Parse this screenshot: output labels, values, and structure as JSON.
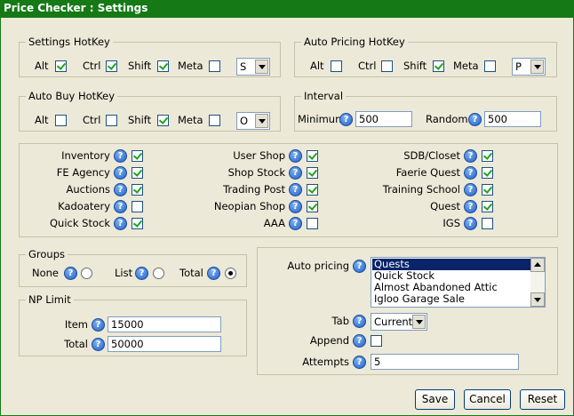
{
  "window": {
    "title": "Price Checker : Settings",
    "accent": "#157a15"
  },
  "settings_hotkey": {
    "legend": "Settings HotKey",
    "alt": "Alt",
    "ctrl": "Ctrl",
    "shift": "Shift",
    "meta": "Meta",
    "alt_checked": true,
    "ctrl_checked": true,
    "shift_checked": true,
    "meta_checked": false,
    "key": "S"
  },
  "auto_pricing_hotkey": {
    "legend": "Auto Pricing HotKey",
    "alt": "Alt",
    "ctrl": "Ctrl",
    "shift": "Shift",
    "meta": "Meta",
    "alt_checked": false,
    "ctrl_checked": false,
    "shift_checked": true,
    "meta_checked": false,
    "key": "P"
  },
  "auto_buy_hotkey": {
    "legend": "Auto Buy HotKey",
    "alt": "Alt",
    "ctrl": "Ctrl",
    "shift": "Shift",
    "meta": "Meta",
    "alt_checked": false,
    "ctrl_checked": false,
    "shift_checked": true,
    "meta_checked": false,
    "key": "O"
  },
  "interval": {
    "legend": "Interval",
    "minimum_label": "Minimum",
    "minimum_value": "500",
    "random_label": "Random",
    "random_value": "500"
  },
  "help_glyph": "?",
  "locations": {
    "col1": [
      {
        "label": "Inventory",
        "checked": true
      },
      {
        "label": "FE Agency",
        "checked": true
      },
      {
        "label": "Auctions",
        "checked": true
      },
      {
        "label": "Kadoatery",
        "checked": false
      },
      {
        "label": "Quick Stock",
        "checked": true
      }
    ],
    "col2": [
      {
        "label": "User Shop",
        "checked": true
      },
      {
        "label": "Shop Stock",
        "checked": true
      },
      {
        "label": "Trading Post",
        "checked": true
      },
      {
        "label": "Neopian Shop",
        "checked": true
      },
      {
        "label": "AAA",
        "checked": false
      }
    ],
    "col3": [
      {
        "label": "SDB/Closet",
        "checked": true
      },
      {
        "label": "Faerie Quest",
        "checked": true
      },
      {
        "label": "Training School",
        "checked": true
      },
      {
        "label": "Quest",
        "checked": true
      },
      {
        "label": "IGS",
        "checked": false
      }
    ]
  },
  "groups": {
    "legend": "Groups",
    "none": "None",
    "list": "List",
    "total": "Total",
    "selected": "Total"
  },
  "np_limit": {
    "legend": "NP Limit",
    "item_label": "Item",
    "item_value": "15000",
    "total_label": "Total",
    "total_value": "50000"
  },
  "auto": {
    "auto_pricing_label": "Auto pricing",
    "list_items": [
      "Quests",
      "Quick Stock",
      "Almost Abandoned Attic",
      "Igloo Garage Sale"
    ],
    "selected_item": "Quests",
    "tab_label": "Tab",
    "tab_value": "Current",
    "append_label": "Append",
    "append_checked": false,
    "attempts_label": "Attempts",
    "attempts_value": "5"
  },
  "buttons": {
    "save": "Save",
    "cancel": "Cancel",
    "reset": "Reset"
  }
}
